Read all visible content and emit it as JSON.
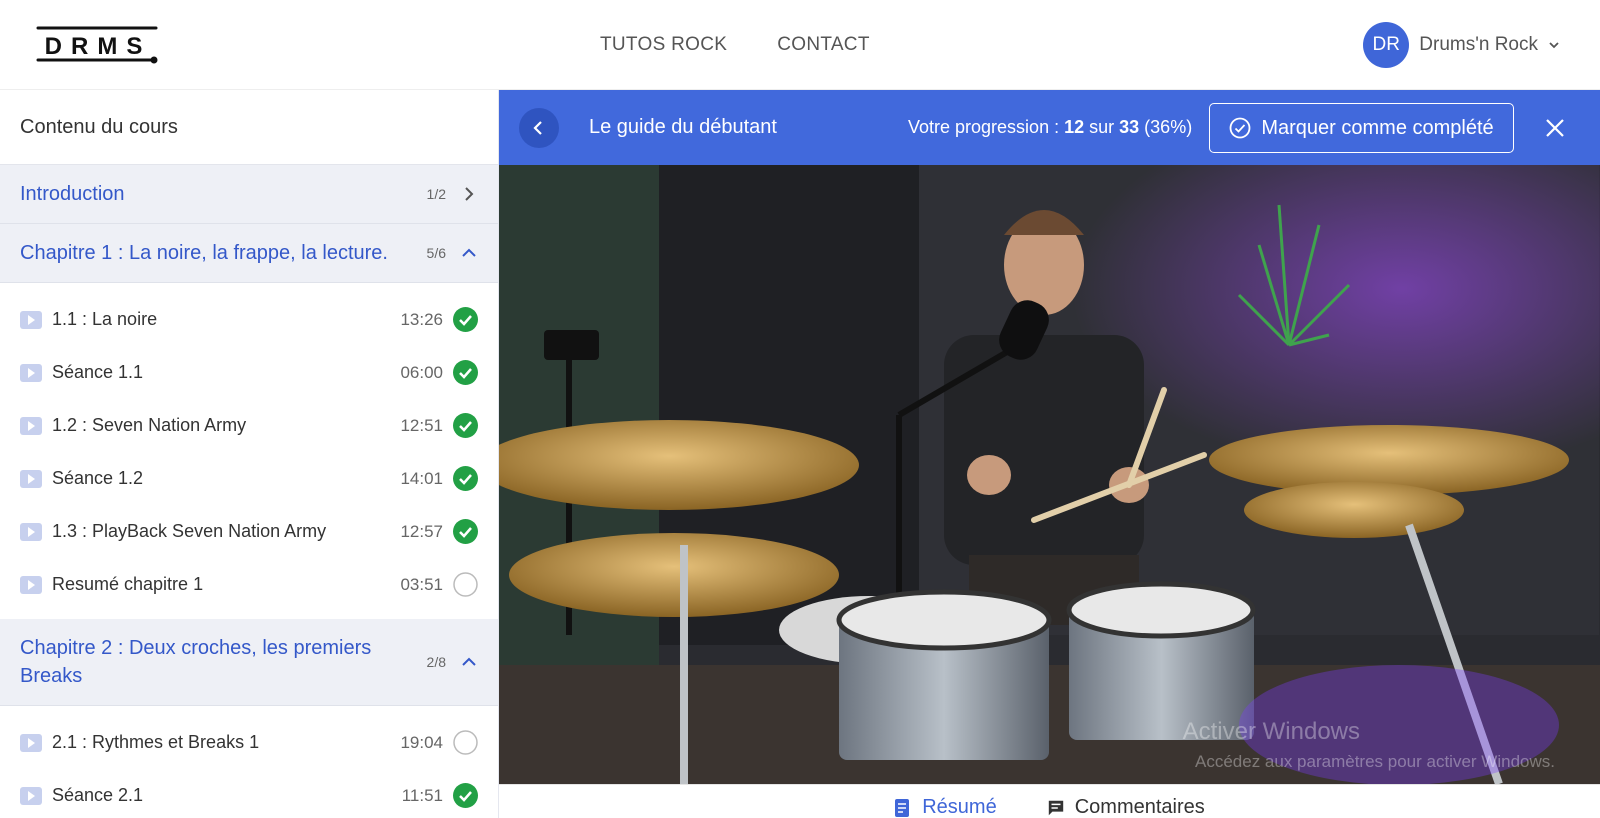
{
  "brand": {
    "logo_text": "DRMS"
  },
  "nav": {
    "links": [
      "TUTOS ROCK",
      "CONTACT"
    ]
  },
  "user": {
    "initials": "DR",
    "name": "Drums'n Rock"
  },
  "sidebar": {
    "title": "Contenu du cours",
    "chapters": [
      {
        "title": "Introduction",
        "count": "1/2",
        "expanded": false
      },
      {
        "title": "Chapitre 1 : La noire, la frappe, la lecture.",
        "count": "5/6",
        "expanded": true,
        "lessons": [
          {
            "title": "1.1 : La noire",
            "time": "13:26",
            "completed": true
          },
          {
            "title": "Séance 1.1",
            "time": "06:00",
            "completed": true
          },
          {
            "title": "1.2 : Seven Nation Army",
            "time": "12:51",
            "completed": true
          },
          {
            "title": "Séance 1.2",
            "time": "14:01",
            "completed": true
          },
          {
            "title": "1.3 : PlayBack Seven Nation Army",
            "time": "12:57",
            "completed": true
          },
          {
            "title": "Resumé chapitre 1",
            "time": "03:51",
            "completed": false
          }
        ]
      },
      {
        "title": "Chapitre 2 : Deux croches, les premiers Breaks",
        "count": "2/8",
        "expanded": true,
        "lessons": [
          {
            "title": "2.1 : Rythmes et Breaks 1",
            "time": "19:04",
            "completed": false
          },
          {
            "title": "Séance 2.1",
            "time": "11:51",
            "completed": true
          }
        ]
      }
    ]
  },
  "header": {
    "lesson_title": "Le guide du débutant",
    "progress_prefix": "Votre progression :",
    "progress_done": "12",
    "progress_sep": "sur",
    "progress_total": "33",
    "progress_pct": "(36%)",
    "complete_label": "Marquer comme complété"
  },
  "watermark": {
    "line1": "Activer Windows",
    "line2": "Accédez aux paramètres pour activer Windows."
  },
  "tabs": [
    {
      "label": "Résumé",
      "active": true
    },
    {
      "label": "Commentaires",
      "active": false
    }
  ],
  "colors": {
    "primary": "#4169dc",
    "chapter_text": "#3458c9",
    "done_green": "#22a045"
  }
}
